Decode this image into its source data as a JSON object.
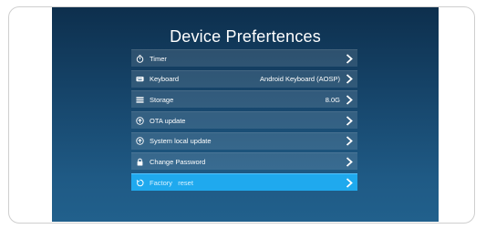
{
  "title": "Device Prefertences",
  "menu": [
    {
      "label": "Timer",
      "value": "",
      "icon": "timer-icon"
    },
    {
      "label": "Keyboard",
      "value": "Android Keyboard (AOSP)",
      "icon": "keyboard-icon"
    },
    {
      "label": "Storage",
      "value": "8.0G",
      "icon": "storage-icon"
    },
    {
      "label": "OTA update",
      "value": "",
      "icon": "upload-circle-icon"
    },
    {
      "label": "System local update",
      "value": "",
      "icon": "upload-circle-icon"
    },
    {
      "label": "Change Password",
      "value": "",
      "icon": "lock-icon"
    },
    {
      "label": "Factory   reset",
      "value": "",
      "icon": "reset-icon",
      "selected": true
    }
  ],
  "colors": {
    "background_top": "#0d2f4d",
    "background_bottom": "#21608c",
    "selected": "#1fa9ee"
  }
}
